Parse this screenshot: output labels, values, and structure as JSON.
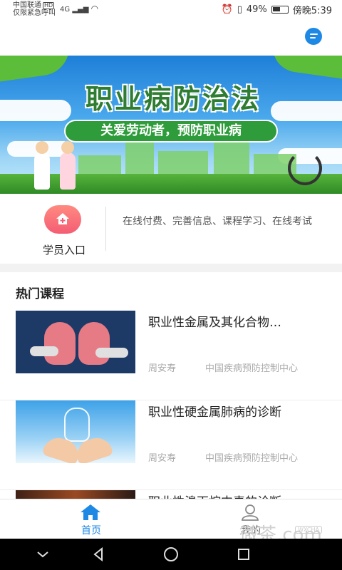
{
  "status_bar": {
    "carrier": "中国联通",
    "carrier_badge": "HD",
    "emergency": "仅限紧急呼叫",
    "network": "4G",
    "battery": "49%",
    "time": "傍晚5:39"
  },
  "banner": {
    "title": "职业病防治法",
    "subtitle": "关爱劳动者，预防职业病"
  },
  "entry": {
    "label": "学员入口",
    "description": "在线付费、完善信息、课程学习、在线考试"
  },
  "hot_courses": {
    "title": "热门课程",
    "items": [
      {
        "title": "职业性金属及其化合物…",
        "author": "周安寿",
        "org": "中国疾病预防控制中心"
      },
      {
        "title": "职业性硬金属肺病的诊断",
        "author": "周安寿",
        "org": "中国疾病预防控制中心"
      },
      {
        "title": "职业性溴丙烷中毒的诊断",
        "author": "",
        "org": ""
      }
    ]
  },
  "bottom_nav": {
    "home": "首页",
    "me": "我的"
  },
  "watermark": {
    "text": "微茶.com",
    "badge": "WXCHA"
  },
  "colors": {
    "accent": "#1e88e5",
    "entry_icon": "#f45d74",
    "banner_green": "#2e9c3a"
  }
}
